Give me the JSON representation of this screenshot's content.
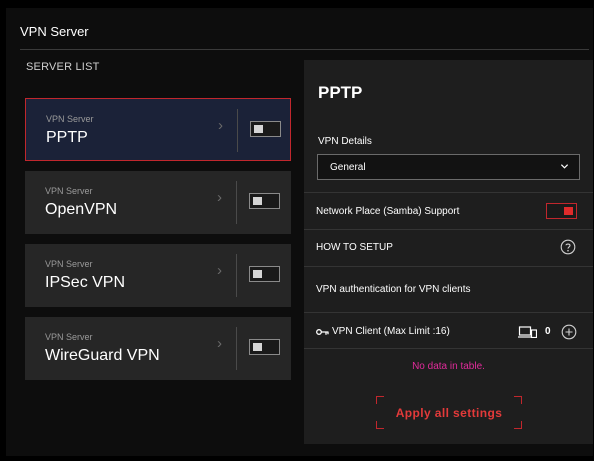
{
  "header": {
    "title": "VPN Server"
  },
  "server_list": {
    "label": "SERVER LIST",
    "items": [
      {
        "caption": "VPN Server",
        "name": "PPTP",
        "selected": true,
        "enabled": false
      },
      {
        "caption": "VPN Server",
        "name": "OpenVPN",
        "selected": false,
        "enabled": false
      },
      {
        "caption": "VPN Server",
        "name": "IPSec VPN",
        "selected": false,
        "enabled": false
      },
      {
        "caption": "VPN Server",
        "name": "WireGuard VPN",
        "selected": false,
        "enabled": false
      }
    ]
  },
  "detail": {
    "title": "PPTP",
    "vpn_details_label": "VPN Details",
    "select_value": "General",
    "samba_label": "Network Place (Samba) Support",
    "samba_enabled": true,
    "how_to_setup_label": "HOW TO SETUP",
    "auth_label": "VPN authentication for VPN clients",
    "client_label": "VPN Client (Max Limit :16)",
    "client_count": "0",
    "empty_message": "No data in table.",
    "apply_label": "Apply all settings"
  },
  "colors": {
    "accent": "#c1272d",
    "empty_text": "#e02b9a",
    "active_card_bg": "#1b2238"
  },
  "icons": [
    "chevron-right-icon",
    "chevron-down-icon",
    "help-icon",
    "key-icon",
    "devices-icon",
    "add-icon"
  ]
}
